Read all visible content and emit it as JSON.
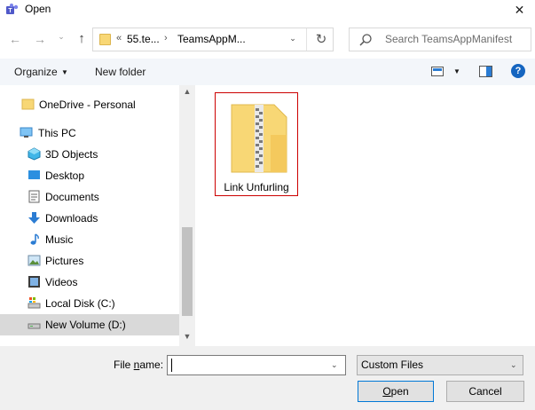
{
  "window": {
    "title": "Open",
    "app_icon": "teams-icon",
    "close_glyph": "✕"
  },
  "nav": {
    "back_glyph": "←",
    "forward_glyph": "→",
    "recent_glyph": "⌄",
    "up_glyph": "↑",
    "refresh_glyph": "↻"
  },
  "address": {
    "overflow": "«",
    "segments": [
      "55.te...",
      "TeamsAppM..."
    ],
    "separator": "›",
    "dropdown_glyph": "⌄"
  },
  "search": {
    "placeholder": "Search TeamsAppManifest"
  },
  "toolbar": {
    "organize_label": "Organize",
    "caret": "▼",
    "new_folder_label": "New folder",
    "help_glyph": "?"
  },
  "sidebar": {
    "items": [
      {
        "label": "OneDrive - Personal",
        "icon": "folder-icon"
      },
      {
        "label": "This PC",
        "icon": "computer-icon"
      },
      {
        "label": "3D Objects",
        "icon": "3d-objects-icon"
      },
      {
        "label": "Desktop",
        "icon": "desktop-icon"
      },
      {
        "label": "Documents",
        "icon": "documents-icon"
      },
      {
        "label": "Downloads",
        "icon": "downloads-icon"
      },
      {
        "label": "Music",
        "icon": "music-icon"
      },
      {
        "label": "Pictures",
        "icon": "pictures-icon"
      },
      {
        "label": "Videos",
        "icon": "videos-icon"
      },
      {
        "label": "Local Disk (C:)",
        "icon": "local-disk-icon"
      },
      {
        "label": "New Volume (D:)",
        "icon": "drive-icon",
        "selected": true
      }
    ],
    "scroll_up": "▲",
    "scroll_down": "▼"
  },
  "files": [
    {
      "name": "Link Unfurling",
      "icon": "zip-folder-icon"
    }
  ],
  "bottom": {
    "file_name_label_pre": "File ",
    "file_name_label_u": "n",
    "file_name_label_post": "ame:",
    "file_name_value": "",
    "file_type": "Custom Files",
    "dropdown_glyph": "⌄",
    "open_label_u": "O",
    "open_label_rest": "pen",
    "cancel_label": "Cancel"
  },
  "colors": {
    "accent": "#0078d7",
    "toolbar_bg": "#f3f6fa",
    "selection": "#d9d9d9",
    "highlight_border": "#cc0000"
  }
}
